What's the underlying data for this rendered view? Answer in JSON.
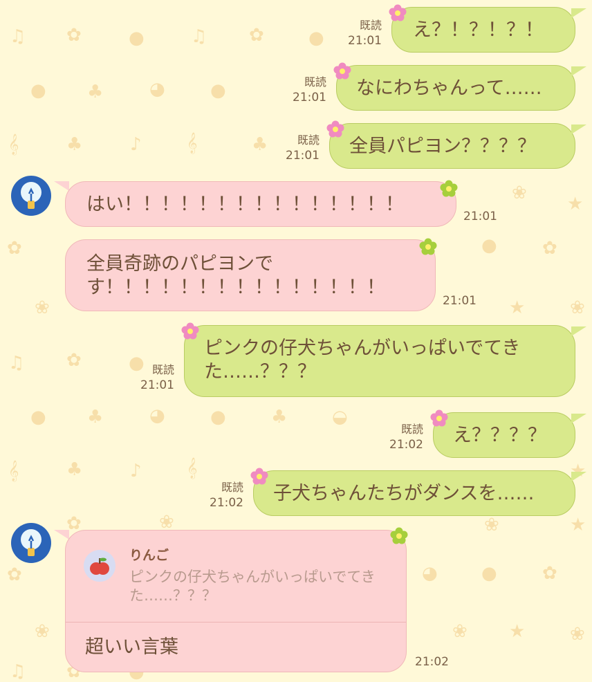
{
  "chat": {
    "messages": [
      {
        "text": "え？！？！？！",
        "read": "既読",
        "time": "21:01"
      },
      {
        "text": "なにわちゃんって……",
        "read": "既読",
        "time": "21:01"
      },
      {
        "text": "全員パピヨン？？？？",
        "read": "既読",
        "time": "21:01"
      },
      {
        "text": "はい！！！！！！！！！！！！！！！",
        "time": "21:01"
      },
      {
        "text": "全員奇跡のパピヨンで\nす！！！！！！！！！！！！！！！",
        "time": "21:01"
      },
      {
        "text": "ピンクの仔犬ちゃんがいっぱいでてき\nた……？？？",
        "read": "既読",
        "time": "21:01"
      },
      {
        "text": "え？？？？",
        "read": "既読",
        "time": "21:02"
      },
      {
        "text": "子犬ちゃんたちがダンスを……",
        "read": "既読",
        "time": "21:02"
      },
      {
        "reply_name": "りんご",
        "reply_quote": "ピンクの仔犬ちゃんがいっぱいでてき\nた……？？？",
        "text": "超いい言葉",
        "time": "21:02"
      }
    ]
  },
  "colors": {
    "background": "#fff9d8",
    "my_bubble": "#d9e98c",
    "their_bubble": "#fdd3d3",
    "text": "#6e5038",
    "wallpaper_icons": "#f7dfaa"
  },
  "icons": {
    "my_sticker": "pink-flower-icon",
    "their_sticker": "green-flower-icon",
    "avatar": "lightbulb-icon",
    "reply_avatar": "apple-icon"
  }
}
